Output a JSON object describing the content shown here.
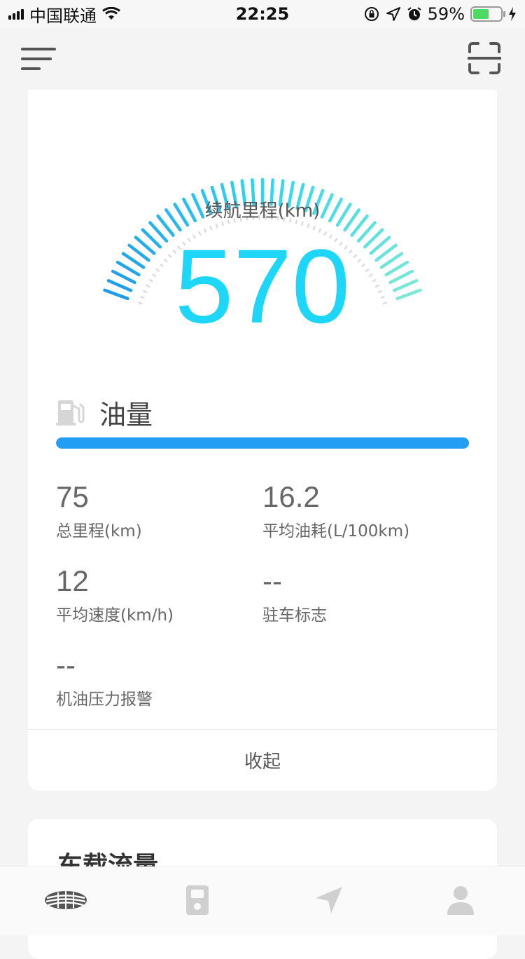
{
  "status_bar": {
    "carrier": "中国联通",
    "time": "22:25",
    "battery_percent": "59%",
    "battery_level": 0.59,
    "icons": [
      "signal-icon",
      "wifi-icon",
      "orientation-lock-icon",
      "location-icon",
      "alarm-icon",
      "battery-icon",
      "charging-icon"
    ]
  },
  "nav": {
    "menu_icon": "menu-icon",
    "scan_icon": "scan-icon"
  },
  "gauge": {
    "label": "续航里程(km)",
    "value": "570",
    "colors": {
      "start": "#1e9be9",
      "mid": "#2fd6f0",
      "end": "#7ee8d4"
    }
  },
  "fuel": {
    "label": "油量",
    "icon": "fuel-pump-icon",
    "level": 1.0,
    "bar_color": "#239ef5"
  },
  "stats": [
    {
      "value": "75",
      "label": "总里程(km)"
    },
    {
      "value": "16.2",
      "label": "平均油耗(L/100km)"
    },
    {
      "value": "12",
      "label": "平均速度(km/h)"
    },
    {
      "value": "--",
      "label": "驻车标志"
    },
    {
      "value": "--",
      "label": "机油压力报警"
    }
  ],
  "collapse_label": "收起",
  "card2": {
    "title": "车载流量"
  },
  "tabbar": {
    "tabs": [
      {
        "icon": "car-brand-icon"
      },
      {
        "icon": "remote-key-icon"
      },
      {
        "icon": "navigation-icon"
      },
      {
        "icon": "profile-icon"
      }
    ]
  }
}
